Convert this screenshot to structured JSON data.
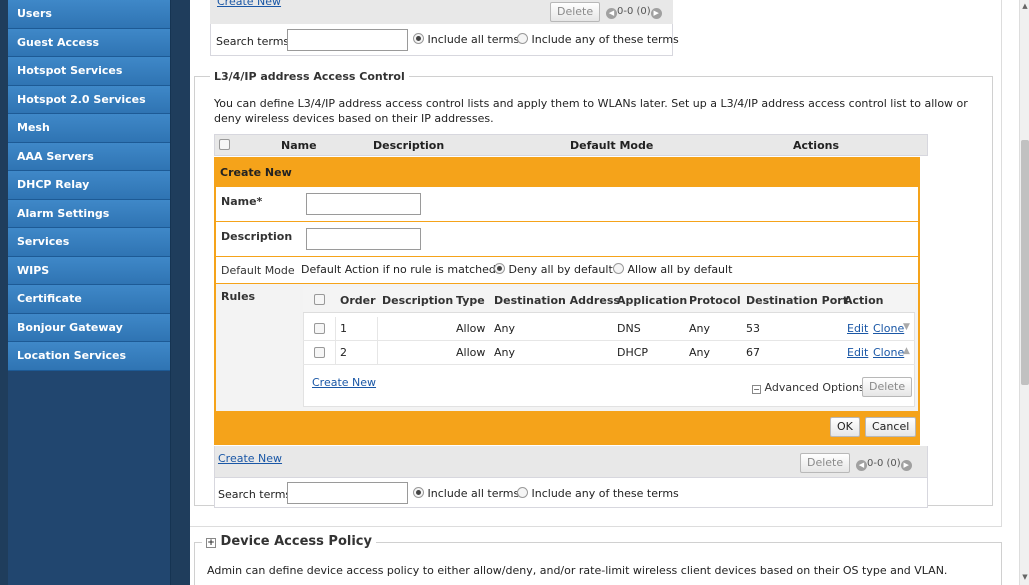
{
  "sidebar": {
    "items": [
      {
        "label": "Users"
      },
      {
        "label": "Guest Access"
      },
      {
        "label": "Hotspot Services"
      },
      {
        "label": "Hotspot 2.0 Services"
      },
      {
        "label": "Mesh"
      },
      {
        "label": "AAA Servers"
      },
      {
        "label": "DHCP Relay"
      },
      {
        "label": "Alarm Settings"
      },
      {
        "label": "Services"
      },
      {
        "label": "WIPS"
      },
      {
        "label": "Certificate"
      },
      {
        "label": "Bonjour Gateway"
      },
      {
        "label": "Location Services"
      }
    ]
  },
  "top_section": {
    "create_new": "Create New",
    "delete": "Delete",
    "pager": "0-0 (0)",
    "search_label": "Search terms",
    "search_value": "",
    "include_all": "Include all terms",
    "include_any": "Include any of these terms"
  },
  "l3": {
    "legend": "L3/4/IP address Access Control",
    "description": "You can define L3/4/IP address access control lists and apply them to WLANs later. Set up a L3/4/IP address access control list to allow or deny wireless devices based on their IP addresses.",
    "columns": [
      "Name",
      "Description",
      "Default Mode",
      "Actions"
    ],
    "create_panel": {
      "title": "Create New",
      "name_label": "Name*",
      "name_value": "",
      "description_label": "Description",
      "description_value": "",
      "default_mode_label": "Default Mode",
      "default_action_text": "Default Action if no rule is matched:",
      "deny_all": "Deny all by default",
      "allow_all": "Allow all by default",
      "rules_label": "Rules",
      "rules_columns": [
        "Order",
        "Description",
        "Type",
        "Destination Address",
        "Application",
        "Protocol",
        "Destination Port",
        "Action"
      ],
      "rules": [
        {
          "order": "1",
          "description": "",
          "type": "Allow",
          "dest": "Any",
          "app": "DNS",
          "protocol": "Any",
          "port": "53",
          "edit": "Edit",
          "clone": "Clone"
        },
        {
          "order": "2",
          "description": "",
          "type": "Allow",
          "dest": "Any",
          "app": "DHCP",
          "protocol": "Any",
          "port": "67",
          "edit": "Edit",
          "clone": "Clone"
        }
      ],
      "rules_create_new": "Create New",
      "advanced_options": "Advanced Options",
      "rules_delete": "Delete",
      "ok": "OK",
      "cancel": "Cancel"
    },
    "create_new": "Create New",
    "delete": "Delete",
    "pager": "0-0 (0)",
    "search_label": "Search terms",
    "search_value": "",
    "include_all": "Include all terms",
    "include_any": "Include any of these terms"
  },
  "device_policy": {
    "legend": "Device Access Policy",
    "description": "Admin can define device access policy to either allow/deny, and/or rate-limit wireless client devices based on their OS type and VLAN."
  }
}
